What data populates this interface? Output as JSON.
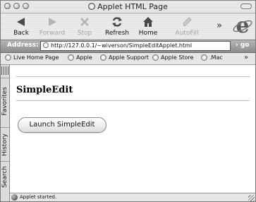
{
  "window": {
    "title": "Applet HTML Page"
  },
  "toolbar": {
    "buttons": [
      {
        "label": "Back",
        "icon": "back-arrow-icon",
        "enabled": true
      },
      {
        "label": "Forward",
        "icon": "forward-arrow-icon",
        "enabled": false
      },
      {
        "label": "Stop",
        "icon": "stop-x-icon",
        "enabled": false
      },
      {
        "label": "Refresh",
        "icon": "refresh-icon",
        "enabled": true
      },
      {
        "label": "Home",
        "icon": "home-icon",
        "enabled": true
      },
      {
        "label": "AutoFill",
        "icon": "autofill-pen-icon",
        "enabled": false
      }
    ],
    "more_glyph": "»"
  },
  "address": {
    "label": "Address:",
    "url": "http://127.0.0.1/~wiverson/SimpleEditApplet.html",
    "go_label": "go"
  },
  "favorites": {
    "items": [
      "Live Home Page",
      "Apple",
      "Apple Support",
      "Apple Store",
      ".Mac"
    ],
    "more_glyph": "»"
  },
  "sidebar": {
    "tabs": [
      "Favorites",
      "History",
      "Search"
    ]
  },
  "page": {
    "heading": "SimpleEdit",
    "button_label": "Launch SimpleEdit"
  },
  "status": {
    "text": "Applet started."
  }
}
